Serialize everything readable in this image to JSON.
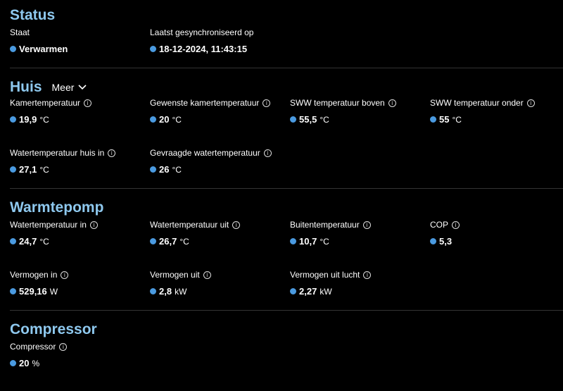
{
  "status": {
    "title": "Status",
    "items": [
      {
        "label": "Staat",
        "value": "Verwarmen",
        "unit": ""
      },
      {
        "label": "Laatst gesynchroniseerd op",
        "value": "18-12-2024, 11:43:15",
        "unit": ""
      }
    ]
  },
  "huis": {
    "title": "Huis",
    "more_label": "Meer",
    "items": [
      {
        "label": "Kamertemperatuur",
        "value": "19,9",
        "unit": "°C"
      },
      {
        "label": "Gewenste kamertemperatuur",
        "value": "20",
        "unit": "°C"
      },
      {
        "label": "SWW temperatuur boven",
        "value": "55,5",
        "unit": "°C"
      },
      {
        "label": "SWW temperatuur onder",
        "value": "55",
        "unit": "°C"
      },
      {
        "label": "Watertemperatuur huis in",
        "value": "27,1",
        "unit": "°C"
      },
      {
        "label": "Gevraagde watertemperatuur",
        "value": "26",
        "unit": "°C"
      }
    ]
  },
  "warmtepomp": {
    "title": "Warmtepomp",
    "items": [
      {
        "label": "Watertemperatuur in",
        "value": "24,7",
        "unit": "°C"
      },
      {
        "label": "Watertemperatuur uit",
        "value": "26,7",
        "unit": "°C"
      },
      {
        "label": "Buitentemperatuur",
        "value": "10,7",
        "unit": "°C"
      },
      {
        "label": "COP",
        "value": "5,3",
        "unit": ""
      },
      {
        "label": "Vermogen in",
        "value": "529,16",
        "unit": "W"
      },
      {
        "label": "Vermogen uit",
        "value": "2,8",
        "unit": "kW"
      },
      {
        "label": "Vermogen uit lucht",
        "value": "2,27",
        "unit": "kW"
      }
    ]
  },
  "compressor": {
    "title": "Compressor",
    "items": [
      {
        "label": "Compressor",
        "value": "20",
        "unit": "%"
      }
    ]
  },
  "colors": {
    "accent": "#8ec8ee",
    "dot": "#4a9ae0",
    "background": "#000000"
  }
}
